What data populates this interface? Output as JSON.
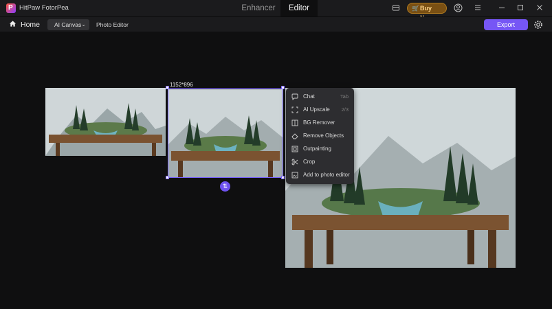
{
  "app": {
    "title": "HitPaw FotorPea",
    "logo_letter": "P"
  },
  "tabs": [
    {
      "label": "Enhancer"
    },
    {
      "label": "Editor"
    }
  ],
  "titlebar": {
    "buy_now_label": "Buy Now"
  },
  "toolbar": {
    "home_label": "Home",
    "canvas_select": "AI Canvas",
    "photo_editor_label": "Photo Editor",
    "export_label": "Export"
  },
  "canvas": {
    "selected_dimensions": "1152*896"
  },
  "context_menu": {
    "items": [
      {
        "label": "Chat",
        "shortcut": "Tab",
        "icon": "chat-icon"
      },
      {
        "label": "AI Upscale",
        "shortcut": "2/3",
        "icon": "upscale-icon"
      },
      {
        "label": "BG Remover",
        "shortcut": "",
        "icon": "bg-remover-icon"
      },
      {
        "label": "Remove Objects",
        "shortcut": "",
        "icon": "eraser-icon"
      },
      {
        "label": "Outpainting",
        "shortcut": "",
        "icon": "outpainting-icon"
      },
      {
        "label": "Crop",
        "shortcut": "",
        "icon": "crop-icon"
      },
      {
        "label": "Add to photo editor",
        "shortcut": "",
        "icon": "add-image-icon"
      }
    ]
  },
  "colors": {
    "accent": "#7656f5",
    "buy_now": "#7a5013",
    "background": "#0f0f10"
  }
}
